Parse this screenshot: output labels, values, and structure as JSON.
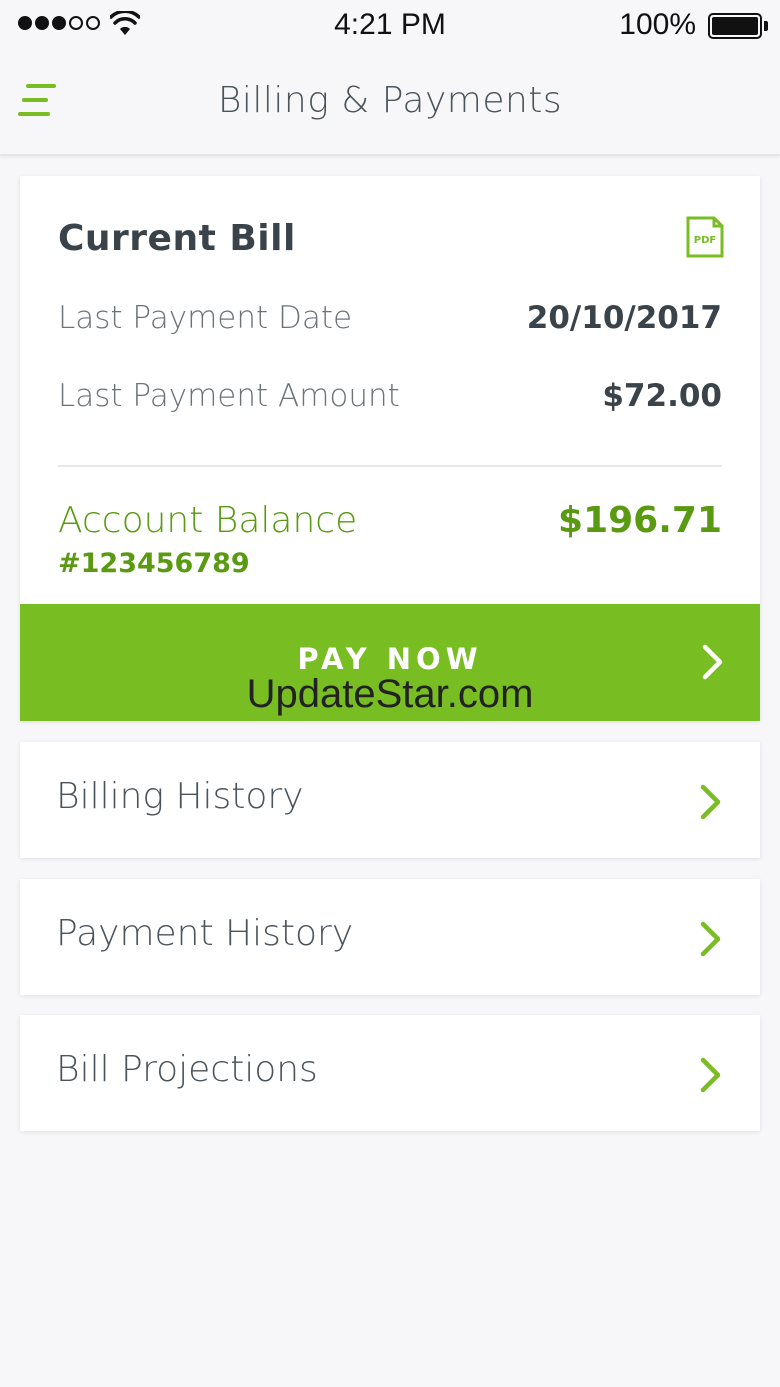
{
  "status_bar": {
    "time": "4:21 PM",
    "battery_percent": "100%",
    "signal_bars": 3,
    "signal_total": 5
  },
  "nav": {
    "title": "Billing & Payments",
    "menu_icon": "hamburger-menu-icon"
  },
  "current_bill": {
    "title": "Current Bill",
    "pdf_icon": "pdf-icon",
    "last_payment_date_label": "Last Payment Date",
    "last_payment_date_value": "20/10/2017",
    "last_payment_amount_label": "Last Payment Amount",
    "last_payment_amount_value": "$72.00",
    "account_balance_label": "Account Balance",
    "account_balance_value": "$196.71",
    "account_number": "#123456789",
    "pay_now_label": "PAY NOW"
  },
  "watermark": "UpdateStar.com",
  "menu_items": [
    {
      "label": "Billing History"
    },
    {
      "label": "Payment History"
    },
    {
      "label": "Bill Projections"
    }
  ],
  "colors": {
    "accent": "#78bd21",
    "accent_text": "#5a9a12",
    "background": "#f7f7f9"
  }
}
